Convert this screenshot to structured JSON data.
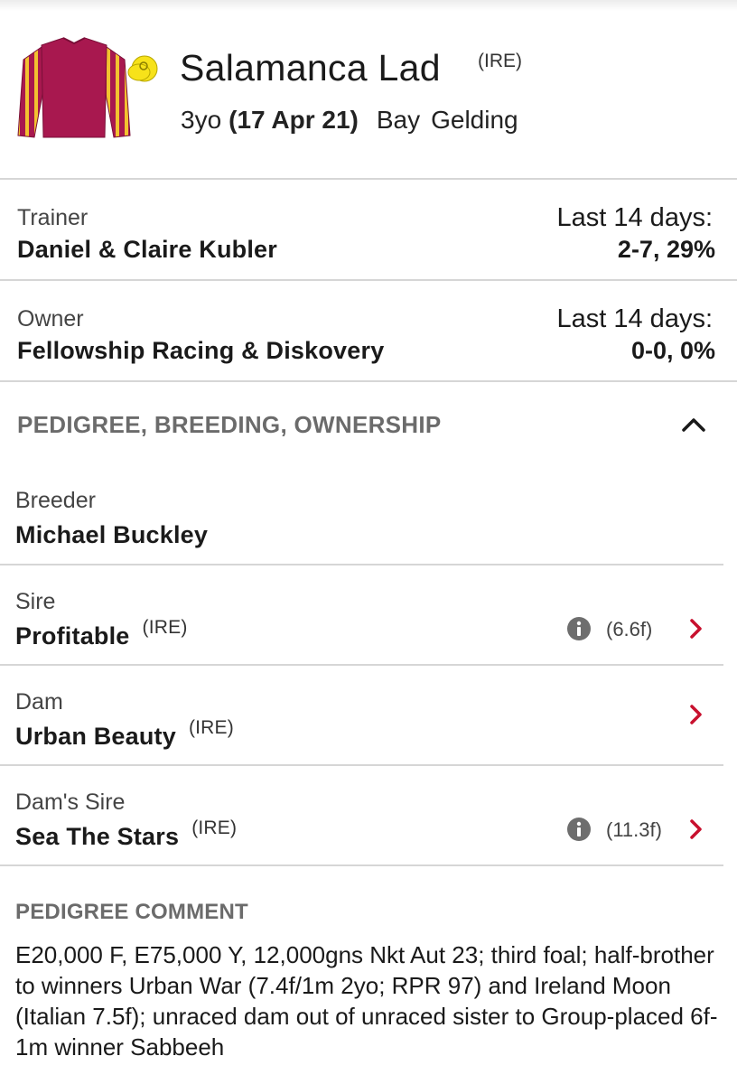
{
  "horse": {
    "name": "Salamanca Lad",
    "origin": "(IRE)",
    "age": "3yo",
    "dob": "(17 Apr 21)",
    "colour": "Bay",
    "sex": "Gelding",
    "silks": {
      "body_color": "#a8184f",
      "sleeve_stripe_colors": [
        "#a8184f",
        "#f2c230"
      ],
      "cap_color": "#f7e21a"
    }
  },
  "trainer": {
    "role": "Trainer",
    "name": "Daniel & Claire Kubler",
    "stat_label": "Last 14 days:",
    "stat_value": "2-7, 29%"
  },
  "owner": {
    "role": "Owner",
    "name": "Fellowship Racing & Diskovery",
    "stat_label": "Last 14 days:",
    "stat_value": "0-0, 0%"
  },
  "section": {
    "title": "PEDIGREE, BREEDING, OWNERSHIP",
    "toggle_icon": "chevron-up-icon"
  },
  "breeder": {
    "role": "Breeder",
    "name": "Michael Buckley"
  },
  "sire": {
    "role": "Sire",
    "name": "Profitable",
    "origin": "(IRE)",
    "distance": "(6.6f)"
  },
  "dam": {
    "role": "Dam",
    "name": "Urban Beauty",
    "origin": "(IRE)"
  },
  "dams_sire": {
    "role": "Dam's Sire",
    "name": "Sea The Stars",
    "origin": "(IRE)",
    "distance": "(11.3f)"
  },
  "comment": {
    "title": "PEDIGREE COMMENT",
    "text": "E20,000 F, E75,000 Y, 12,000gns Nkt Aut 23; third foal; half-brother to winners Urban War (7.4f/1m 2yo; RPR 97) and Ireland Moon (Italian 7.5f); unraced dam out of unraced sister to Group-placed 6f-1m winner Sabbeeh"
  },
  "colors": {
    "accent_red": "#c8102e",
    "section_grey": "#6b6b6b",
    "divider": "#d6d6d6"
  }
}
